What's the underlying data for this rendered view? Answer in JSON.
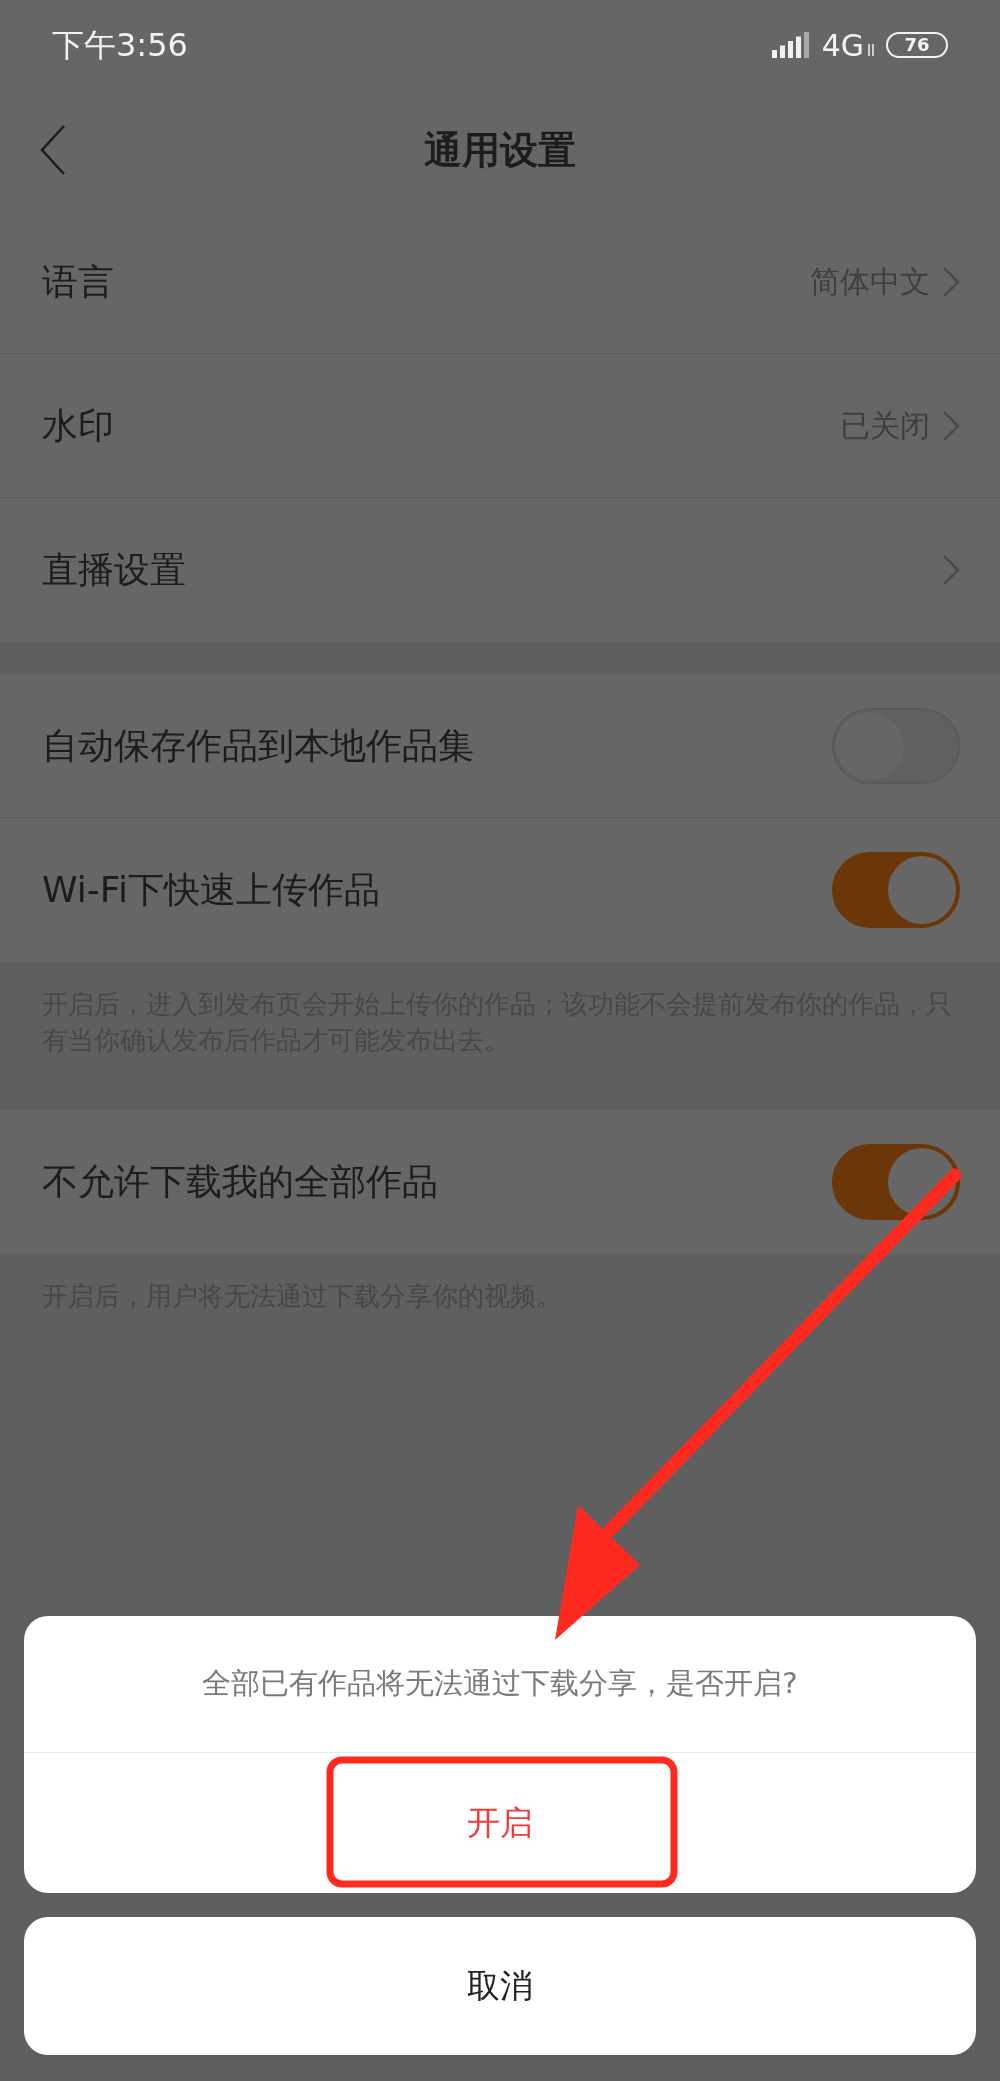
{
  "status_bar": {
    "time": "下午3:56",
    "network": "4G",
    "battery": "76"
  },
  "header": {
    "title": "通用设置"
  },
  "groups": [
    {
      "rows": [
        {
          "kind": "link",
          "label": "语言",
          "value": "简体中文"
        },
        {
          "kind": "link",
          "label": "水印",
          "value": "已关闭"
        },
        {
          "kind": "link",
          "label": "直播设置"
        }
      ]
    },
    {
      "rows": [
        {
          "kind": "toggle",
          "label": "自动保存作品到本地作品集",
          "on": false
        },
        {
          "kind": "toggle",
          "label": "Wi-Fi下快速上传作品",
          "on": true
        }
      ],
      "note": "开启后，进入到发布页会开始上传你的作品；该功能不会提前发布你的作品，只有当你确认发布后作品才可能发布出去。"
    },
    {
      "rows": [
        {
          "kind": "toggle",
          "label": "不允许下载我的全部作品",
          "on": true
        }
      ],
      "note": "开启后，用户将无法通过下载分享你的视频。"
    }
  ],
  "action_sheet": {
    "message": "全部已有作品将无法通过下载分享，是否开启?",
    "actions": [
      "开启"
    ],
    "cancel": "取消"
  }
}
